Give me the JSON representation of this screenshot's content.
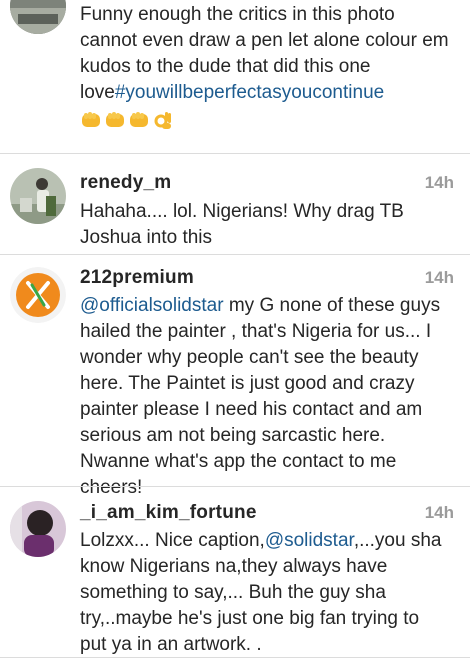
{
  "comments": [
    {
      "username": "",
      "time": "",
      "text_pre": "Funny enough the critics in this photo cannot even draw a pen let alone colour em kudos to the dude that did this one love",
      "hashtag": "#youwillbeperfectasyoucontinue",
      "emoji": [
        "oncoming-fist",
        "oncoming-fist",
        "oncoming-fist",
        "ok-hand"
      ]
    },
    {
      "username": "renedy_m",
      "time": "14h",
      "text": "Hahaha.... lol. Nigerians! Why drag TB Joshua into this"
    },
    {
      "username": "212premium",
      "time": "14h",
      "mention": "@officialsolidstar",
      "text_post": " my G none of these guys hailed the painter , that's Nigeria for us... I wonder why people can't see the beauty here. The Paintet is just good and crazy painter please I need his contact and am serious am not being sarcastic here. Nwanne what's app the contact to me cheers!"
    },
    {
      "username": "_i_am_kim_fortune",
      "time": "14h",
      "text_pre": "Lolzxx... Nice caption,",
      "mention": "@solidstar",
      "text_post": ",...you sha know Nigerians na,they always have something to say,... Buh the guy sha try,..maybe he's just one big fan trying to put ya in an artwork. ."
    }
  ],
  "colors": {
    "link": "#1d5b8f",
    "text": "#262626",
    "time": "#9b9b9b",
    "divider": "#dcdcdc"
  }
}
